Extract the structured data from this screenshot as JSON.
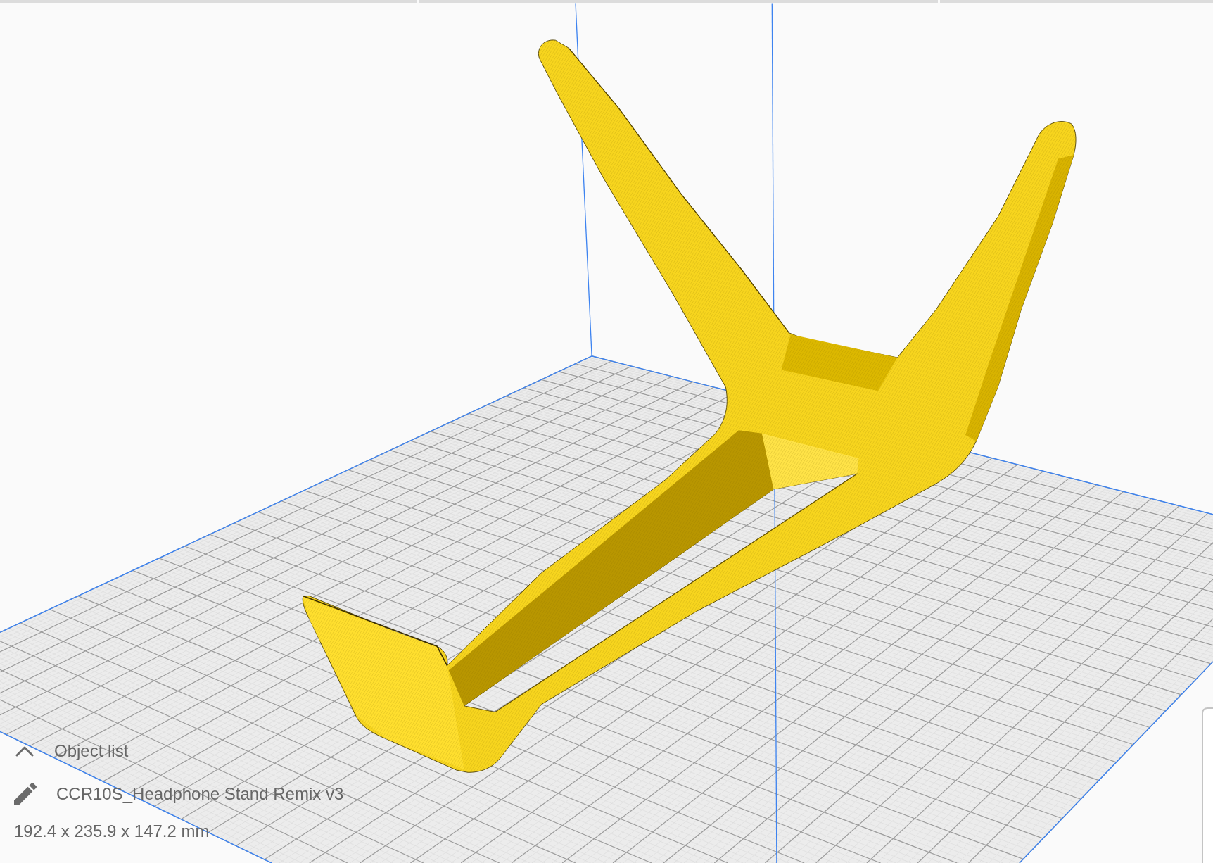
{
  "object_list": {
    "title": "Object list",
    "expanded": false
  },
  "object": {
    "name": "CCR10S_Headphone Stand Remix v3",
    "dimensions": "192.4 x 235.9 x 147.2 mm"
  }
}
